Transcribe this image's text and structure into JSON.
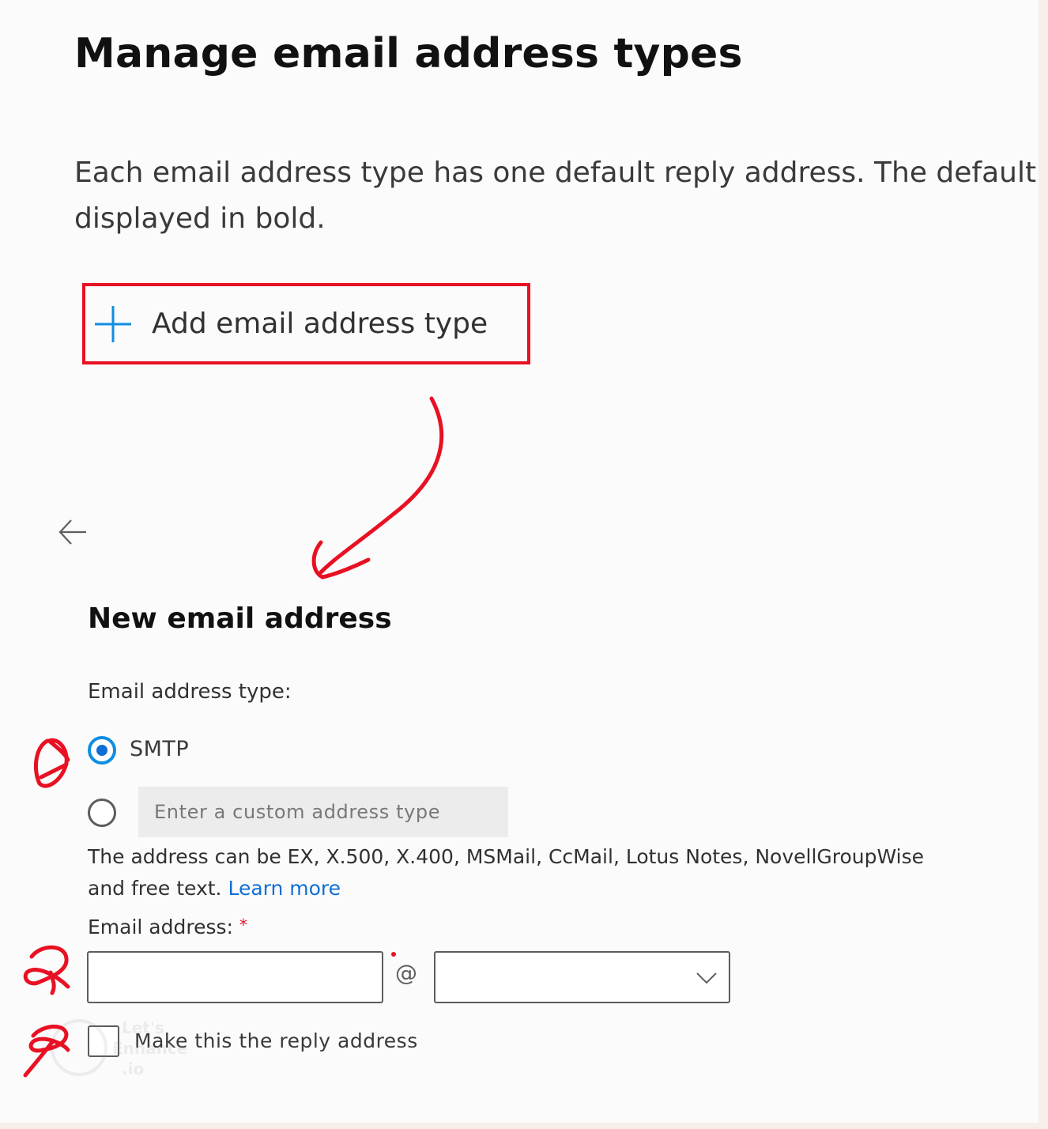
{
  "top_panel": {
    "title": "Manage email address types",
    "description_line1": "Each email address type has one default reply address. The default",
    "description_line2": "displayed in bold.",
    "add_button_label": "Add email address type"
  },
  "new_email_panel": {
    "title": "New email address",
    "type_label": "Email address type:",
    "smtp_label": "SMTP",
    "custom_type_placeholder": "Enter a custom address type",
    "help_line1": "The address can be EX, X.500, X.400, MSMail, CcMail, Lotus Notes, NovellGroupWise",
    "help_line2": "and free text.",
    "learn_more": "Learn more",
    "email_label": "Email address:",
    "required_marker": "*",
    "at_sign": "@",
    "reply_checkbox_label": "Make this the reply address",
    "selected_type": "SMTP",
    "reply_checked": false
  },
  "watermark": {
    "text_line1": "Let's",
    "text_line2": "Enhance",
    "text_line3": ".io"
  },
  "icons": {
    "add": "plus-icon",
    "back": "back-arrow-icon",
    "dropdown": "chevron-down-icon"
  },
  "colors": {
    "accent": "#0f6fd6",
    "annotation_red": "#e81123",
    "radio_ring": "#0f8ee0"
  }
}
